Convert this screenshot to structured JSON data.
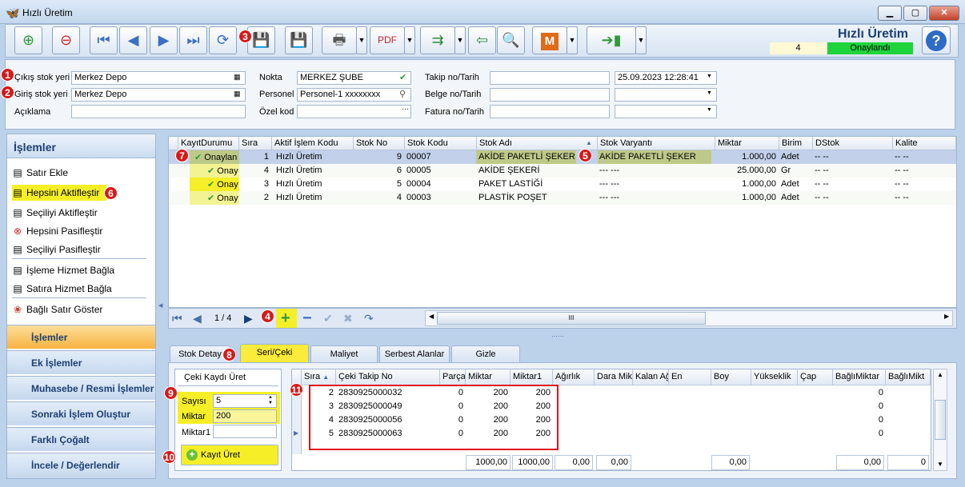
{
  "window": {
    "title": "Hızlı Üretim",
    "min": "▁",
    "max": "▢",
    "close": "✕"
  },
  "header": {
    "title": "Hızlı Üretim",
    "count": "4",
    "status": "Onaylandı"
  },
  "form": {
    "cikis_label": "Çıkış stok yeri",
    "cikis_value": "Merkez Depo",
    "giris_label": "Giriş stok yeri",
    "giris_value": "Merkez Depo",
    "aciklama_label": "Açıklama",
    "nokta_label": "Nokta",
    "nokta_value": "MERKEZ ŞUBE",
    "personel_label": "Personel",
    "personel_value": "Personel-1 xxxxxxxx",
    "ozelkod_label": "Özel kod",
    "takip_label": "Takip no/Tarih",
    "takip_date": "25.09.2023 12:28:41",
    "belge_label": "Belge no/Tarih",
    "fatura_label": "Fatura no/Tarih"
  },
  "sidebar": {
    "title": "İşlemler",
    "items": [
      {
        "label": "Satır Ekle"
      },
      {
        "label": "Hepsini Aktifleştir"
      },
      {
        "label": "Seçiliyi Aktifleştir"
      },
      {
        "label": "Hepsini Pasifleştir"
      },
      {
        "label": "Seçiliyi Pasifleştir"
      },
      {
        "label": "İşleme Hizmet Bağla"
      },
      {
        "label": "Satıra Hizmet Bağla"
      },
      {
        "label": "Bağlı Satır Göster"
      }
    ],
    "nav": [
      "İşlemler",
      "Ek İşlemler",
      "Muhasebe / Resmi İşlemler",
      "Sonraki İşlem Oluştur",
      "Farklı Çoğalt",
      "İncele / Değerlendir"
    ]
  },
  "grid1": {
    "columns": [
      "KayıtDurumu",
      "Sıra",
      "Aktif İşlem Kodu",
      "Stok No",
      "Stok Kodu",
      "Stok Adı",
      "Stok Varyantı",
      "Miktar",
      "Birim",
      "DStok",
      "Kalite"
    ],
    "rows": [
      {
        "durum": "Onaylan",
        "sira": "1",
        "islem": "Hızlı Üretim",
        "stokno": "9",
        "stokkodu": "00007",
        "stokadi": "AKİDE PAKETLİ ŞEKER",
        "varyant": "AKİDE PAKETLİ ŞEKER",
        "miktar": "1.000,00",
        "birim": "Adet",
        "dstok": "-- --",
        "kalite": "-- --"
      },
      {
        "durum": "Onay",
        "sira": "4",
        "islem": "Hızlı Üretim",
        "stokno": "6",
        "stokkodu": "00005",
        "stokadi": "AKİDE ŞEKERİ",
        "varyant": "--- ---",
        "miktar": "25.000,00",
        "birim": "Gr",
        "dstok": "-- --",
        "kalite": "-- --"
      },
      {
        "durum": "Onay",
        "sira": "3",
        "islem": "Hızlı Üretim",
        "stokno": "5",
        "stokkodu": "00004",
        "stokadi": "PAKET LASTİĞİ",
        "varyant": "--- ---",
        "miktar": "1.000,00",
        "birim": "Adet",
        "dstok": "-- --",
        "kalite": "-- --"
      },
      {
        "durum": "Onay",
        "sira": "2",
        "islem": "Hızlı Üretim",
        "stokno": "4",
        "stokkodu": "00003",
        "stokadi": "PLASTİK POŞET",
        "varyant": "--- ---",
        "miktar": "1.000,00",
        "birim": "Adet",
        "dstok": "-- --",
        "kalite": "-- --"
      }
    ],
    "pager": "1 / 4",
    "scroll_grip": "III"
  },
  "tabs": [
    "Stok Detay",
    "Seri/Çeki",
    "Maliyet",
    "Serbest Alanlar",
    "Gizle"
  ],
  "ceki": {
    "title": "Çeki Kaydı Üret",
    "sayisi_label": "Sayısı",
    "sayisi_value": "5",
    "miktar_label": "Miktar",
    "miktar_value": "200",
    "miktar1_label": "Miktar1",
    "button": "Kayıt Üret"
  },
  "grid2": {
    "columns": [
      "Sıra",
      "Çeki Takip No",
      "Parça",
      "Miktar",
      "Miktar1",
      "Ağırlık",
      "Dara Mikt",
      "Kalan Ağ",
      "En",
      "Boy",
      "Yükseklik",
      "Çap",
      "BağlıMiktar",
      "BağlıMikt"
    ],
    "rows": [
      {
        "sira": "2",
        "no": "2830925000032",
        "parca": "0",
        "miktar": "200",
        "miktar1": "200",
        "bagli": "0"
      },
      {
        "sira": "3",
        "no": "2830925000049",
        "parca": "0",
        "miktar": "200",
        "miktar1": "200",
        "bagli": "0"
      },
      {
        "sira": "4",
        "no": "2830925000056",
        "parca": "0",
        "miktar": "200",
        "miktar1": "200",
        "bagli": "0"
      },
      {
        "sira": "5",
        "no": "2830925000063",
        "parca": "0",
        "miktar": "200",
        "miktar1": "200",
        "bagli": "0"
      }
    ],
    "footer": {
      "miktar": "1000,00",
      "miktar1": "1000,00",
      "agirlik": "0,00",
      "dara": "0,00",
      "boy": "0,00",
      "bagli": "0,00",
      "bagli2": "0"
    }
  },
  "markers": [
    "1",
    "2",
    "3",
    "4",
    "5",
    "6",
    "7",
    "8",
    "9",
    "10",
    "11"
  ],
  "colors": {
    "highlight": "#f6ef28",
    "status": "#1fd33c",
    "marker": "#d71a1a",
    "selected_row": "#8fa9d9",
    "nav_active": "#f7b240"
  }
}
